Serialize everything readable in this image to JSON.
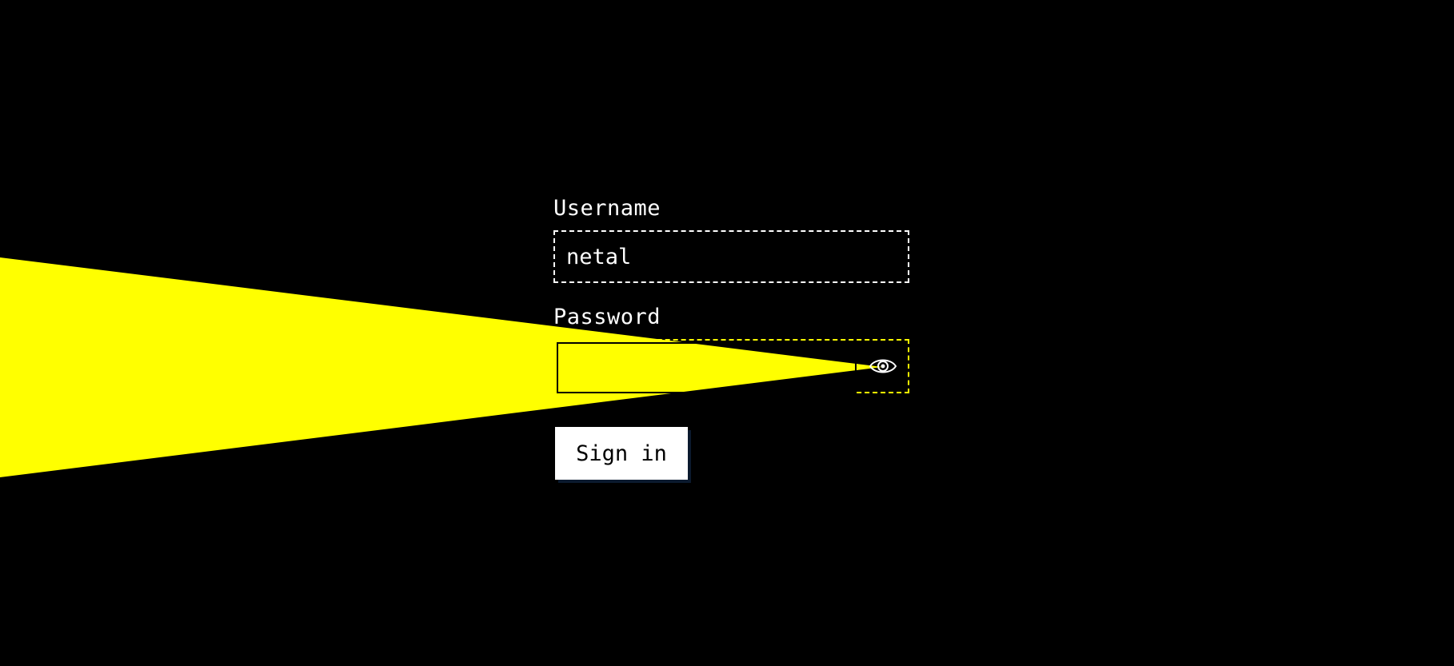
{
  "login": {
    "username_label": "Username",
    "username_value": "netal",
    "password_label": "Password",
    "password_value": "",
    "show_password_icon": "eye-icon",
    "signin_label": "Sign in"
  },
  "colors": {
    "background": "#000000",
    "foreground": "#ffffff",
    "accent": "#ffff00",
    "button_shadow": "#0b1a2e"
  }
}
